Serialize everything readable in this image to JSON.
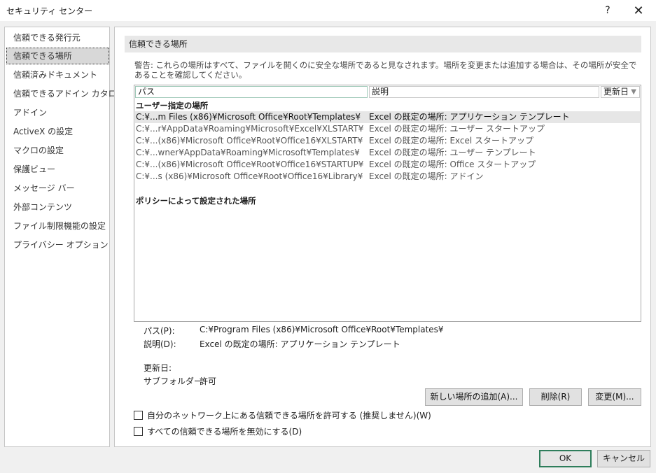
{
  "window": {
    "title": "セキュリティ センター",
    "help_glyph": "?",
    "close_glyph": "✕"
  },
  "sidebar": {
    "items": [
      {
        "label": "信頼できる発行元"
      },
      {
        "label": "信頼できる場所",
        "selected": true
      },
      {
        "label": "信頼済みドキュメント"
      },
      {
        "label": "信頼できるアドイン カタログ"
      },
      {
        "label": "アドイン"
      },
      {
        "label": "ActiveX の設定"
      },
      {
        "label": "マクロの設定"
      },
      {
        "label": "保護ビュー"
      },
      {
        "label": "メッセージ バー"
      },
      {
        "label": "外部コンテンツ"
      },
      {
        "label": "ファイル制限機能の設定"
      },
      {
        "label": "プライバシー オプション"
      }
    ]
  },
  "main": {
    "section_title": "信頼できる場所",
    "warning": "警告: これらの場所はすべて、ファイルを開くのに安全な場所であると見なされます。場所を変更または追加する場合は、その場所が安全であることを確認してください。",
    "columns": {
      "path": "パス",
      "desc": "説明",
      "date": "更新日",
      "date_caret": "▼"
    },
    "user_group": "ユーザー指定の場所",
    "policy_group": "ポリシーによって設定された場所",
    "rows": [
      {
        "path": "C:¥...m Files (x86)¥Microsoft Office¥Root¥Templates¥",
        "desc": "Excel の既定の場所: アプリケーション テンプレート",
        "selected": true
      },
      {
        "path": "C:¥...r¥AppData¥Roaming¥Microsoft¥Excel¥XLSTART¥",
        "desc": "Excel の既定の場所: ユーザー スタートアップ"
      },
      {
        "path": "C:¥...(x86)¥Microsoft Office¥Root¥Office16¥XLSTART¥",
        "desc": "Excel の既定の場所: Excel スタートアップ"
      },
      {
        "path": "C:¥...wner¥AppData¥Roaming¥Microsoft¥Templates¥",
        "desc": "Excel の既定の場所: ユーザー テンプレート"
      },
      {
        "path": "C:¥...(x86)¥Microsoft Office¥Root¥Office16¥STARTUP¥",
        "desc": "Excel の既定の場所: Office スタートアップ"
      },
      {
        "path": "C:¥...s (x86)¥Microsoft Office¥Root¥Office16¥Library¥",
        "desc": "Excel の既定の場所: アドイン"
      }
    ],
    "details": {
      "path_label": "パス(P):",
      "path_value": "C:¥Program Files (x86)¥Microsoft Office¥Root¥Templates¥",
      "desc_label": "説明(D):",
      "desc_value": "Excel の既定の場所: アプリケーション テンプレート",
      "date_label": "更新日:",
      "date_value": "",
      "subfolder_label": "サブフォルダー:",
      "subfolder_value": "許可"
    },
    "buttons": {
      "add": "新しい場所の追加(A)...",
      "remove": "削除(R)",
      "modify": "変更(M)..."
    },
    "checkboxes": {
      "network": "自分のネットワーク上にある信頼できる場所を許可する (推奨しません)(W)",
      "disable_all": "すべての信頼できる場所を無効にする(D)"
    }
  },
  "footer": {
    "ok": "OK",
    "cancel": "キャンセル"
  },
  "colors": {
    "ok_border": "#2e7d5b",
    "selection": "#e6e6e6"
  }
}
